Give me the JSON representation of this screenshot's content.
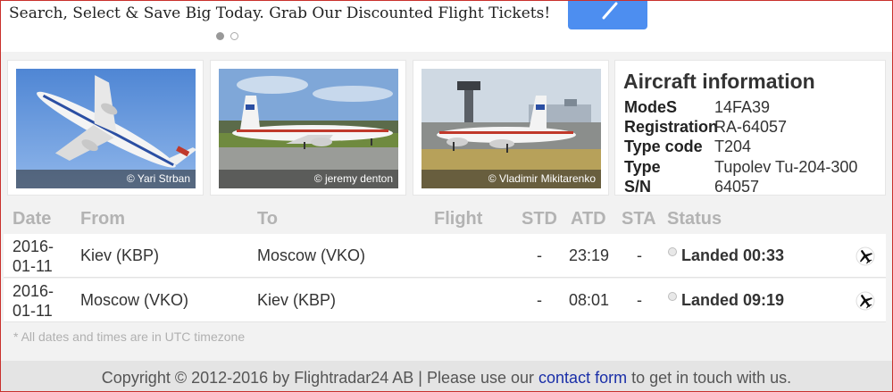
{
  "ad": {
    "text": "Search, Select & Save Big Today. Grab Our Discounted Flight Tickets!",
    "cta_icon": "arrow-icon"
  },
  "photos": [
    {
      "credit": "© Yari Strban"
    },
    {
      "credit": "© jeremy denton"
    },
    {
      "credit": "© Vladimir Mikitarenko"
    }
  ],
  "aircraft": {
    "title": "Aircraft information",
    "rows": [
      {
        "key": "ModeS",
        "value": "14FA39"
      },
      {
        "key": "Registration",
        "value": "RA-64057"
      },
      {
        "key": "Type code",
        "value": "T204"
      },
      {
        "key": "Type",
        "value": "Tupolev Tu-204-300"
      },
      {
        "key": "S/N",
        "value": "64057"
      }
    ]
  },
  "table": {
    "headers": {
      "date": "Date",
      "from": "From",
      "to": "To",
      "flight": "Flight",
      "std": "STD",
      "atd": "ATD",
      "sta": "STA",
      "status": "Status"
    },
    "rows": [
      {
        "date_line1": "2016-",
        "date_line2": "01-11",
        "from": "Kiev (KBP)",
        "to": "Moscow (VKO)",
        "flight": "",
        "std": "-",
        "atd": "23:19",
        "sta": "-",
        "status": "Landed 00:33"
      },
      {
        "date_line1": "2016-",
        "date_line2": "01-11",
        "from": "Moscow (VKO)",
        "to": "Kiev (KBP)",
        "flight": "",
        "std": "-",
        "atd": "08:01",
        "sta": "-",
        "status": "Landed 09:19"
      }
    ],
    "note": "* All dates and times are in UTC timezone"
  },
  "footer": {
    "prefix": "Copyright © 2012-2016 by Flightradar24 AB | Please use our ",
    "link": "contact form",
    "suffix": " to get in touch with us."
  }
}
